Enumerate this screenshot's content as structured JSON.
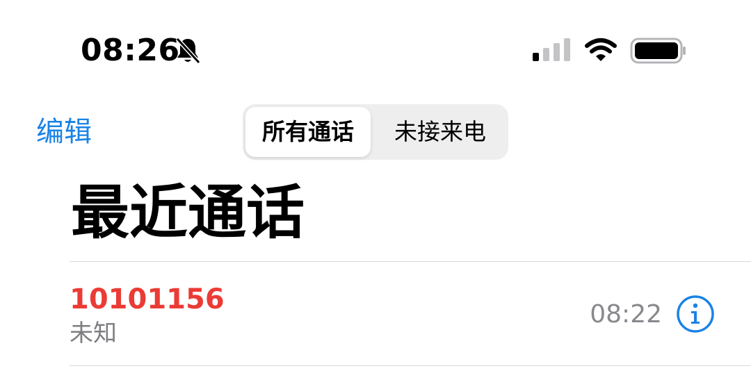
{
  "status_bar": {
    "time": "08:26",
    "icons": [
      "bell-slash-icon",
      "cellular-signal-icon",
      "wifi-icon",
      "battery-icon"
    ]
  },
  "nav": {
    "edit_label": "编辑",
    "segments": [
      {
        "label": "所有通话",
        "selected": true
      },
      {
        "label": "未接来电",
        "selected": false
      }
    ]
  },
  "page": {
    "title": "最近通话"
  },
  "calls": [
    {
      "number": "10101156",
      "subtitle": "未知",
      "time": "08:22",
      "missed": true
    }
  ],
  "colors": {
    "accent": "#1a82e6",
    "missed": "#eb3b35",
    "secondary_text": "#7d7d82"
  }
}
